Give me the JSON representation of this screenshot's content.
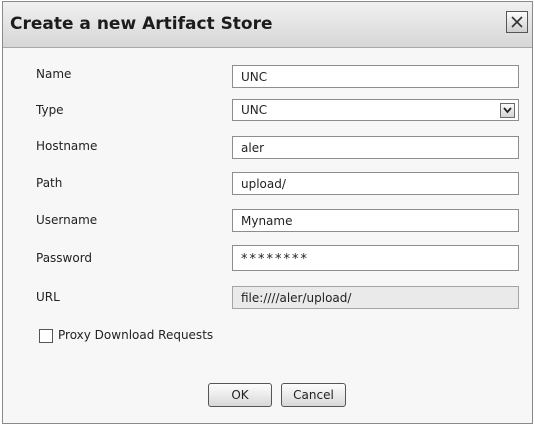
{
  "dialog": {
    "title": "Create a new Artifact Store",
    "close_icon": "close-icon"
  },
  "form": {
    "name": {
      "label": "Name",
      "value": "UNC"
    },
    "type": {
      "label": "Type",
      "value": "UNC",
      "arrow_icon": "chevron-down-icon"
    },
    "hostname": {
      "label": "Hostname",
      "value": "aler"
    },
    "path": {
      "label": "Path",
      "value": "upload/"
    },
    "username": {
      "label": "Username",
      "value": "Myname"
    },
    "password": {
      "label": "Password",
      "value": "********"
    },
    "url": {
      "label": "URL",
      "value": "file:////aler/upload/"
    },
    "proxy": {
      "label": "Proxy Download Requests",
      "checked": false
    }
  },
  "buttons": {
    "ok_label": "OK",
    "cancel_label": "Cancel"
  }
}
